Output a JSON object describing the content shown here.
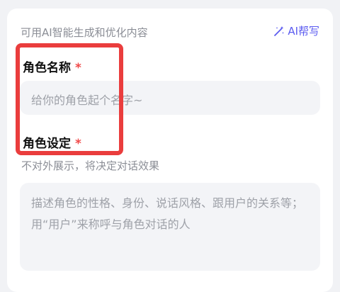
{
  "form": {
    "top_hint": "可用AI智能生成和优化内容",
    "ai_help_label": "AI帮写",
    "ai_help_icon": "magic-wand-icon",
    "accent_color": "#5b5bf0",
    "name": {
      "label": "角色名称",
      "required_mark": "*",
      "placeholder": "给你的角色起个名字~",
      "value": ""
    },
    "setting": {
      "label": "角色设定",
      "required_mark": "*",
      "hint": "不对外展示，将决定对话效果",
      "placeholder": "描述角色的性格、身份、说话风格、跟用户的关系等；用“用户”来称呼与角色对话的人",
      "value": ""
    }
  },
  "annotation": {
    "highlight_color": "#ea3d3d"
  }
}
